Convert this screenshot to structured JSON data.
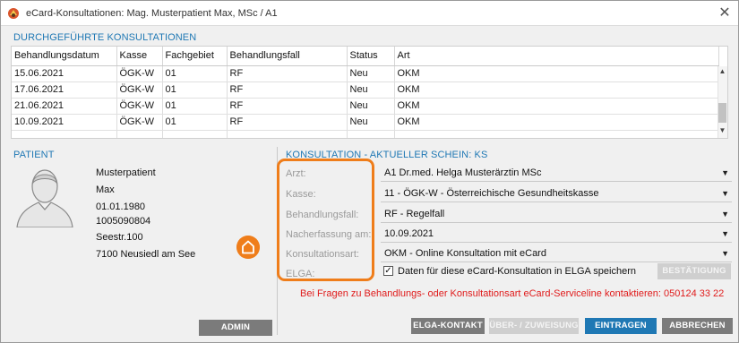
{
  "window": {
    "title": "eCard-Konsultationen: Mag. Musterpatient Max, MSc / A1",
    "close_symbol": "✕"
  },
  "consultations": {
    "section_title": "DURCHGEFÜHRTE KONSULTATIONEN",
    "columns": [
      "Behandlungsdatum",
      "Kasse",
      "Fachgebiet",
      "Behandlungsfall",
      "Status",
      "Art"
    ],
    "rows": [
      [
        "15.06.2021",
        "ÖGK-W",
        "01",
        "RF",
        "Neu",
        "OKM"
      ],
      [
        "17.06.2021",
        "ÖGK-W",
        "01",
        "RF",
        "Neu",
        "OKM"
      ],
      [
        "21.06.2021",
        "ÖGK-W",
        "01",
        "RF",
        "Neu",
        "OKM"
      ],
      [
        "10.09.2021",
        "ÖGK-W",
        "01",
        "RF",
        "Neu",
        "OKM"
      ]
    ]
  },
  "patient": {
    "section_title": "PATIENT",
    "lines": [
      "Musterpatient",
      "Max",
      "01.01.1980",
      "1005090804",
      "Seestr.100",
      "7100 Neusiedl am See"
    ],
    "admin_label": "ADMIN"
  },
  "consultation_form": {
    "section_title": "KONSULTATION - AKTUELLER SCHEIN: KS",
    "fields": [
      {
        "label": "Arzt:",
        "value": "A1   Dr.med. Helga Musterärztin MSc"
      },
      {
        "label": "Kasse:",
        "value": "11 - ÖGK-W - Österreichische Gesundheitskasse"
      },
      {
        "label": "Behandlungsfall:",
        "value": "RF - Regelfall"
      },
      {
        "label": "Nacherfassung am:",
        "value": "10.09.2021"
      },
      {
        "label": "Konsultationsart:",
        "value": "OKM - Online Konsultation mit eCard"
      },
      {
        "label": "ELGA:",
        "value": ""
      }
    ],
    "elga_checkbox_label": "Daten für diese eCard-Konsultation in ELGA speichern",
    "elga_checked": true,
    "bestaetigung_label": "BESTÄTIGUNG",
    "info_text": "Bei Fragen zu Behandlungs- oder Konsultationsart eCard-Serviceline kontaktieren: 050124 33 22"
  },
  "buttons": {
    "elga_kontakt": "ELGA-KONTAKT",
    "ueberweisung": "ÜBER- / ZUWEISUNG",
    "eintragen": "EINTRAGEN",
    "abbrechen": "ABBRECHEN"
  },
  "colors": {
    "accent_blue": "#1f78b4",
    "highlight_orange": "#ef7d1a",
    "warning_red": "#e01b1b"
  },
  "icons": {
    "app": "app-logo-icon",
    "patient": "user-silhouette-icon",
    "home": "home-icon",
    "scroll_up": "chevron-up-icon",
    "scroll_down": "chevron-down-icon",
    "dropdown": "caret-down-icon"
  }
}
